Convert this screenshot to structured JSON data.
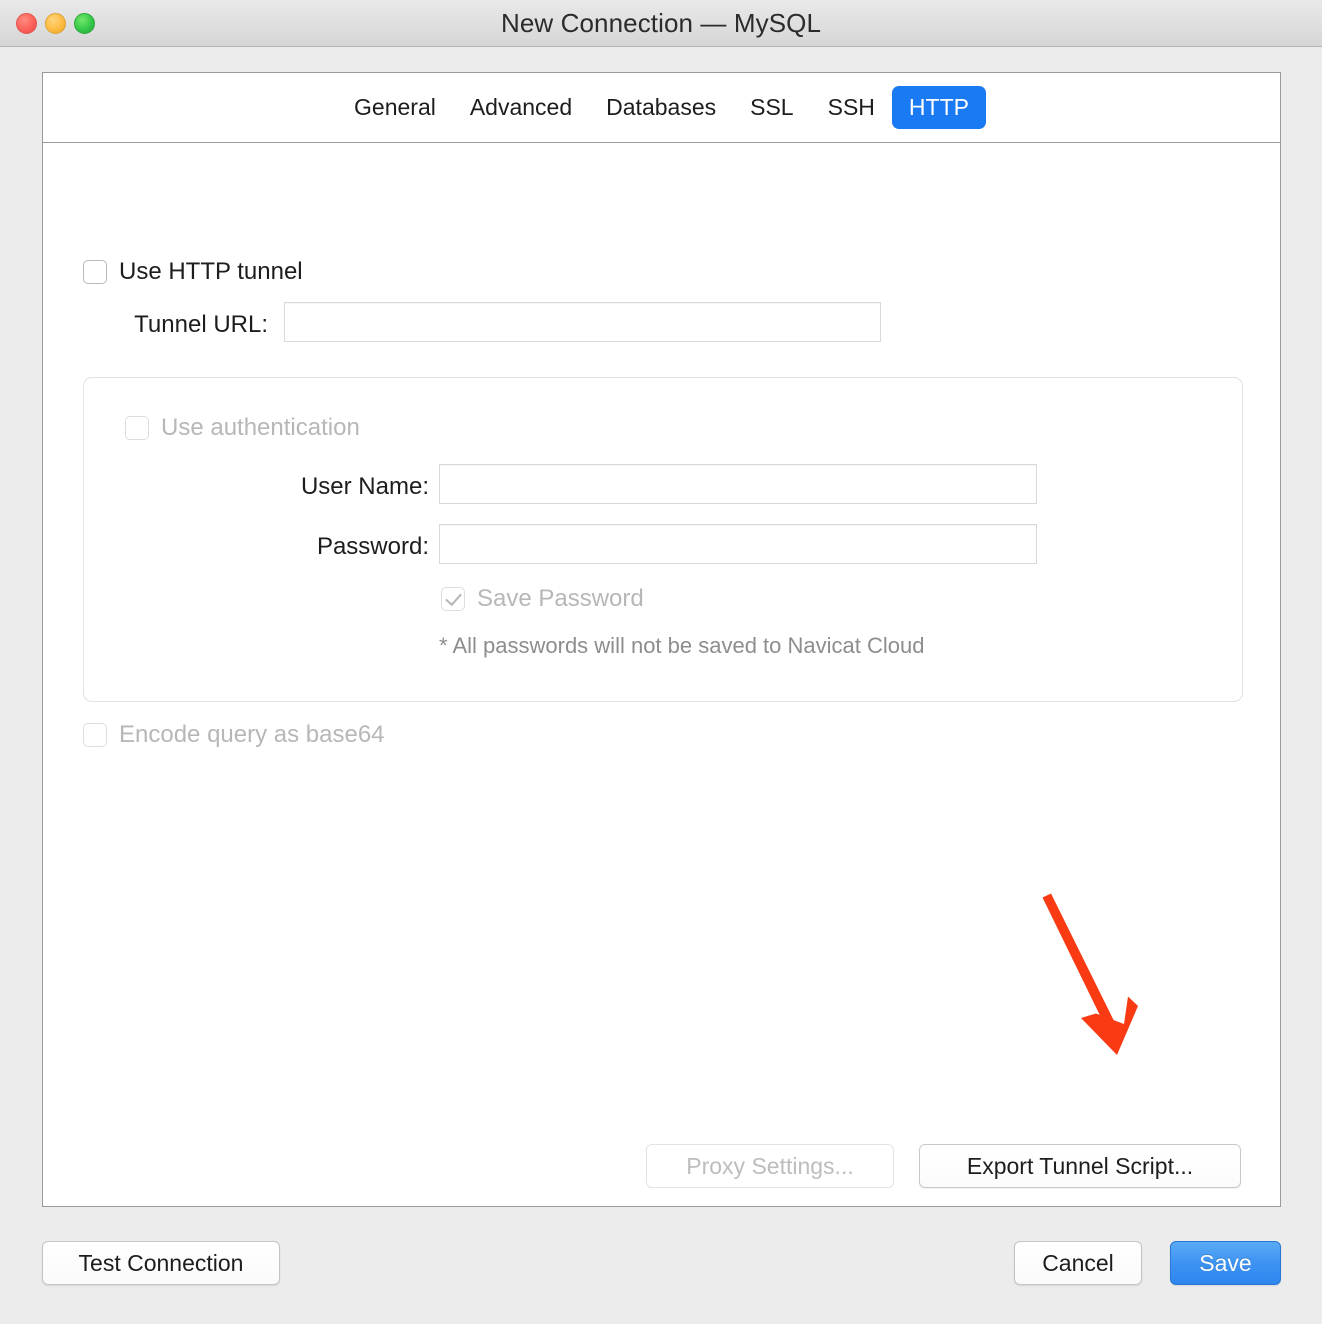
{
  "window": {
    "title": "New Connection — MySQL",
    "traffic_lights": [
      {
        "name": "close",
        "color": "#fb6158"
      },
      {
        "name": "minimize",
        "color": "#fdbc40"
      },
      {
        "name": "maximize",
        "color": "#34c749"
      }
    ]
  },
  "tabs": [
    {
      "label": "General",
      "active": false
    },
    {
      "label": "Advanced",
      "active": false
    },
    {
      "label": "Databases",
      "active": false
    },
    {
      "label": "SSL",
      "active": false
    },
    {
      "label": "SSH",
      "active": false
    },
    {
      "label": "HTTP",
      "active": true
    }
  ],
  "http": {
    "use_http_tunnel": {
      "label": "Use HTTP tunnel",
      "checked": false,
      "enabled": true
    },
    "tunnel_url": {
      "label": "Tunnel URL:",
      "value": "",
      "placeholder": ""
    },
    "auth_group": {
      "use_authentication": {
        "label": "Use authentication",
        "checked": false,
        "enabled": false
      },
      "user_name": {
        "label": "User Name:",
        "value": "",
        "placeholder": ""
      },
      "password": {
        "label": "Password:",
        "value": "",
        "placeholder": ""
      },
      "save_password": {
        "label": "Save Password",
        "checked": true,
        "enabled": false
      },
      "cloud_note": "* All passwords will not be saved to Navicat Cloud"
    },
    "encode_query": {
      "label": "Encode query as base64",
      "checked": false,
      "enabled": false
    },
    "proxy_settings_label": "Proxy Settings...",
    "export_tunnel_script_label": "Export Tunnel Script..."
  },
  "footer": {
    "test_connection_label": "Test Connection",
    "cancel_label": "Cancel",
    "save_label": "Save"
  },
  "annotation": {
    "type": "arrow",
    "color": "#f93a13",
    "points_to": "Export Tunnel Script..."
  },
  "colors": {
    "accent_blue": "#1a7af4",
    "save_button_blue": "#2f86ef",
    "annotation_red": "#f93a13",
    "window_background": "#ececec",
    "panel_background": "#ffffff"
  }
}
